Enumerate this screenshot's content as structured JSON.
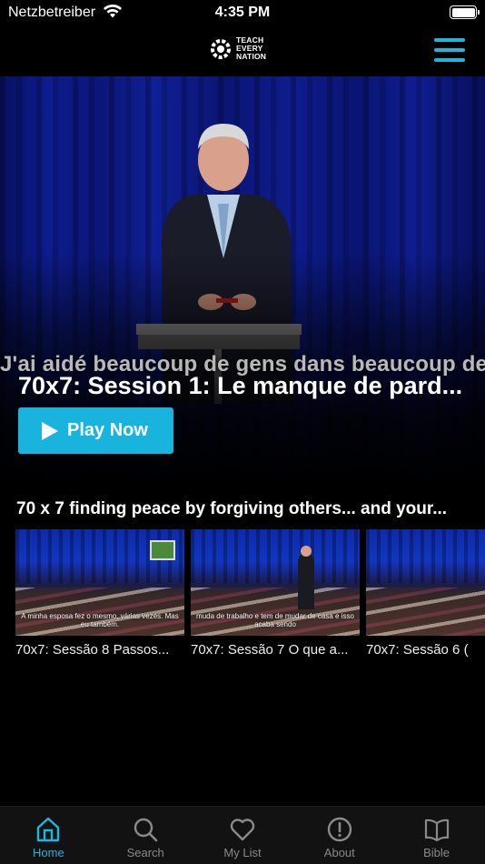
{
  "status_bar": {
    "carrier": "Netzbetreiber",
    "time": "4:35 PM"
  },
  "header": {
    "logo_line1": "TEACH",
    "logo_line2": "EVERY",
    "logo_line3": "NATION",
    "accent_color": "#1fb5df"
  },
  "hero": {
    "subtitle_overlay": "J'ai aidé beaucoup de gens dans beaucoup de",
    "title": "70x7: Session 1: Le manque de pard...",
    "play_label": "Play Now"
  },
  "series": {
    "title": "70 x 7 finding peace by forgiving others... and your...",
    "episodes": [
      {
        "label": "70x7: Sessão 8 Passos...",
        "caption": "A minha esposa fez o mesmo, várias vezes. Mas eu também."
      },
      {
        "label": "70x7: Sessão 7 O que a...",
        "caption": "muda de trabalho e tem de mudar de casa e isso acaba sendo"
      },
      {
        "label": "70x7: Sessão 6 (",
        "caption": ""
      }
    ]
  },
  "tabs": [
    {
      "label": "Home",
      "icon": "home-icon",
      "active": true
    },
    {
      "label": "Search",
      "icon": "search-icon",
      "active": false
    },
    {
      "label": "My List",
      "icon": "heart-icon",
      "active": false
    },
    {
      "label": "About",
      "icon": "info-icon",
      "active": false
    },
    {
      "label": "Bible",
      "icon": "book-icon",
      "active": false
    }
  ]
}
